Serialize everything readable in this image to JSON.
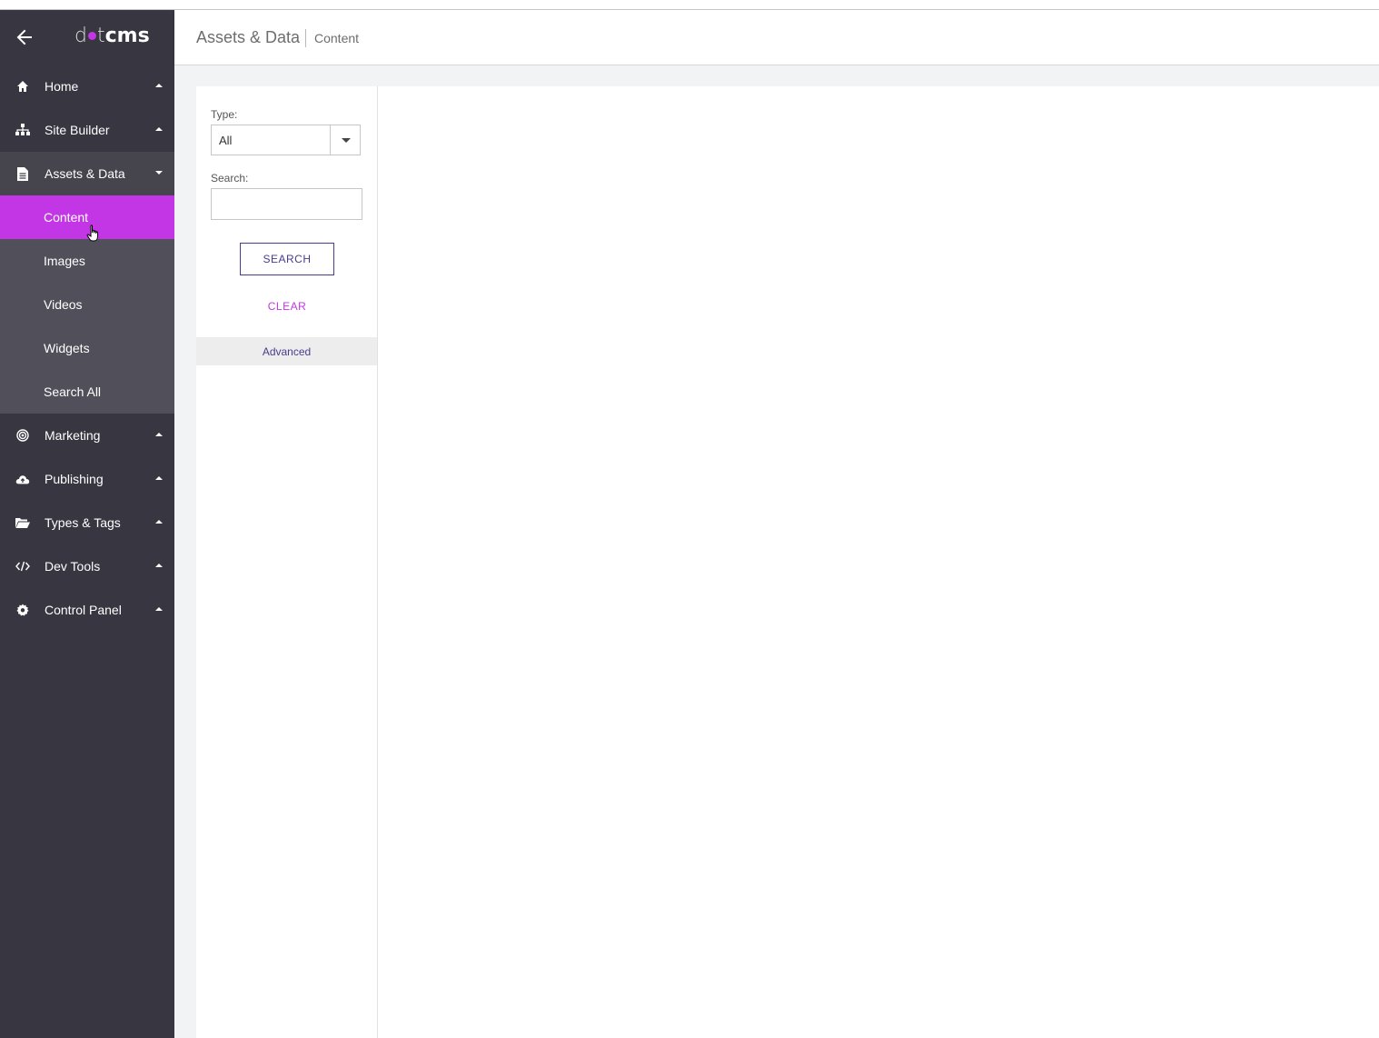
{
  "brand": {
    "logo_prefix": "d",
    "logo_mid": "t",
    "logo_bold": "cms",
    "accent": "#c336e5",
    "sidebar_bg": "#373641"
  },
  "header": {
    "section": "Assets & Data",
    "page": "Content"
  },
  "sidebar": {
    "items": [
      {
        "label": "Home",
        "icon": "home-icon"
      },
      {
        "label": "Site Builder",
        "icon": "sitemap-icon"
      },
      {
        "label": "Assets & Data",
        "icon": "file-icon"
      },
      {
        "label": "Marketing",
        "icon": "target-icon"
      },
      {
        "label": "Publishing",
        "icon": "cloud-upload-icon"
      },
      {
        "label": "Types & Tags",
        "icon": "folder-open-icon"
      },
      {
        "label": "Dev Tools",
        "icon": "code-icon"
      },
      {
        "label": "Control Panel",
        "icon": "gear-icon"
      }
    ],
    "subitems": [
      {
        "label": "Content",
        "active": true
      },
      {
        "label": "Images"
      },
      {
        "label": "Videos"
      },
      {
        "label": "Widgets"
      },
      {
        "label": "Search All"
      }
    ]
  },
  "filters": {
    "type_label": "Type:",
    "type_value": "All",
    "search_label": "Search:",
    "search_value": "",
    "search_button": "SEARCH",
    "clear_button": "CLEAR",
    "advanced": "Advanced"
  }
}
